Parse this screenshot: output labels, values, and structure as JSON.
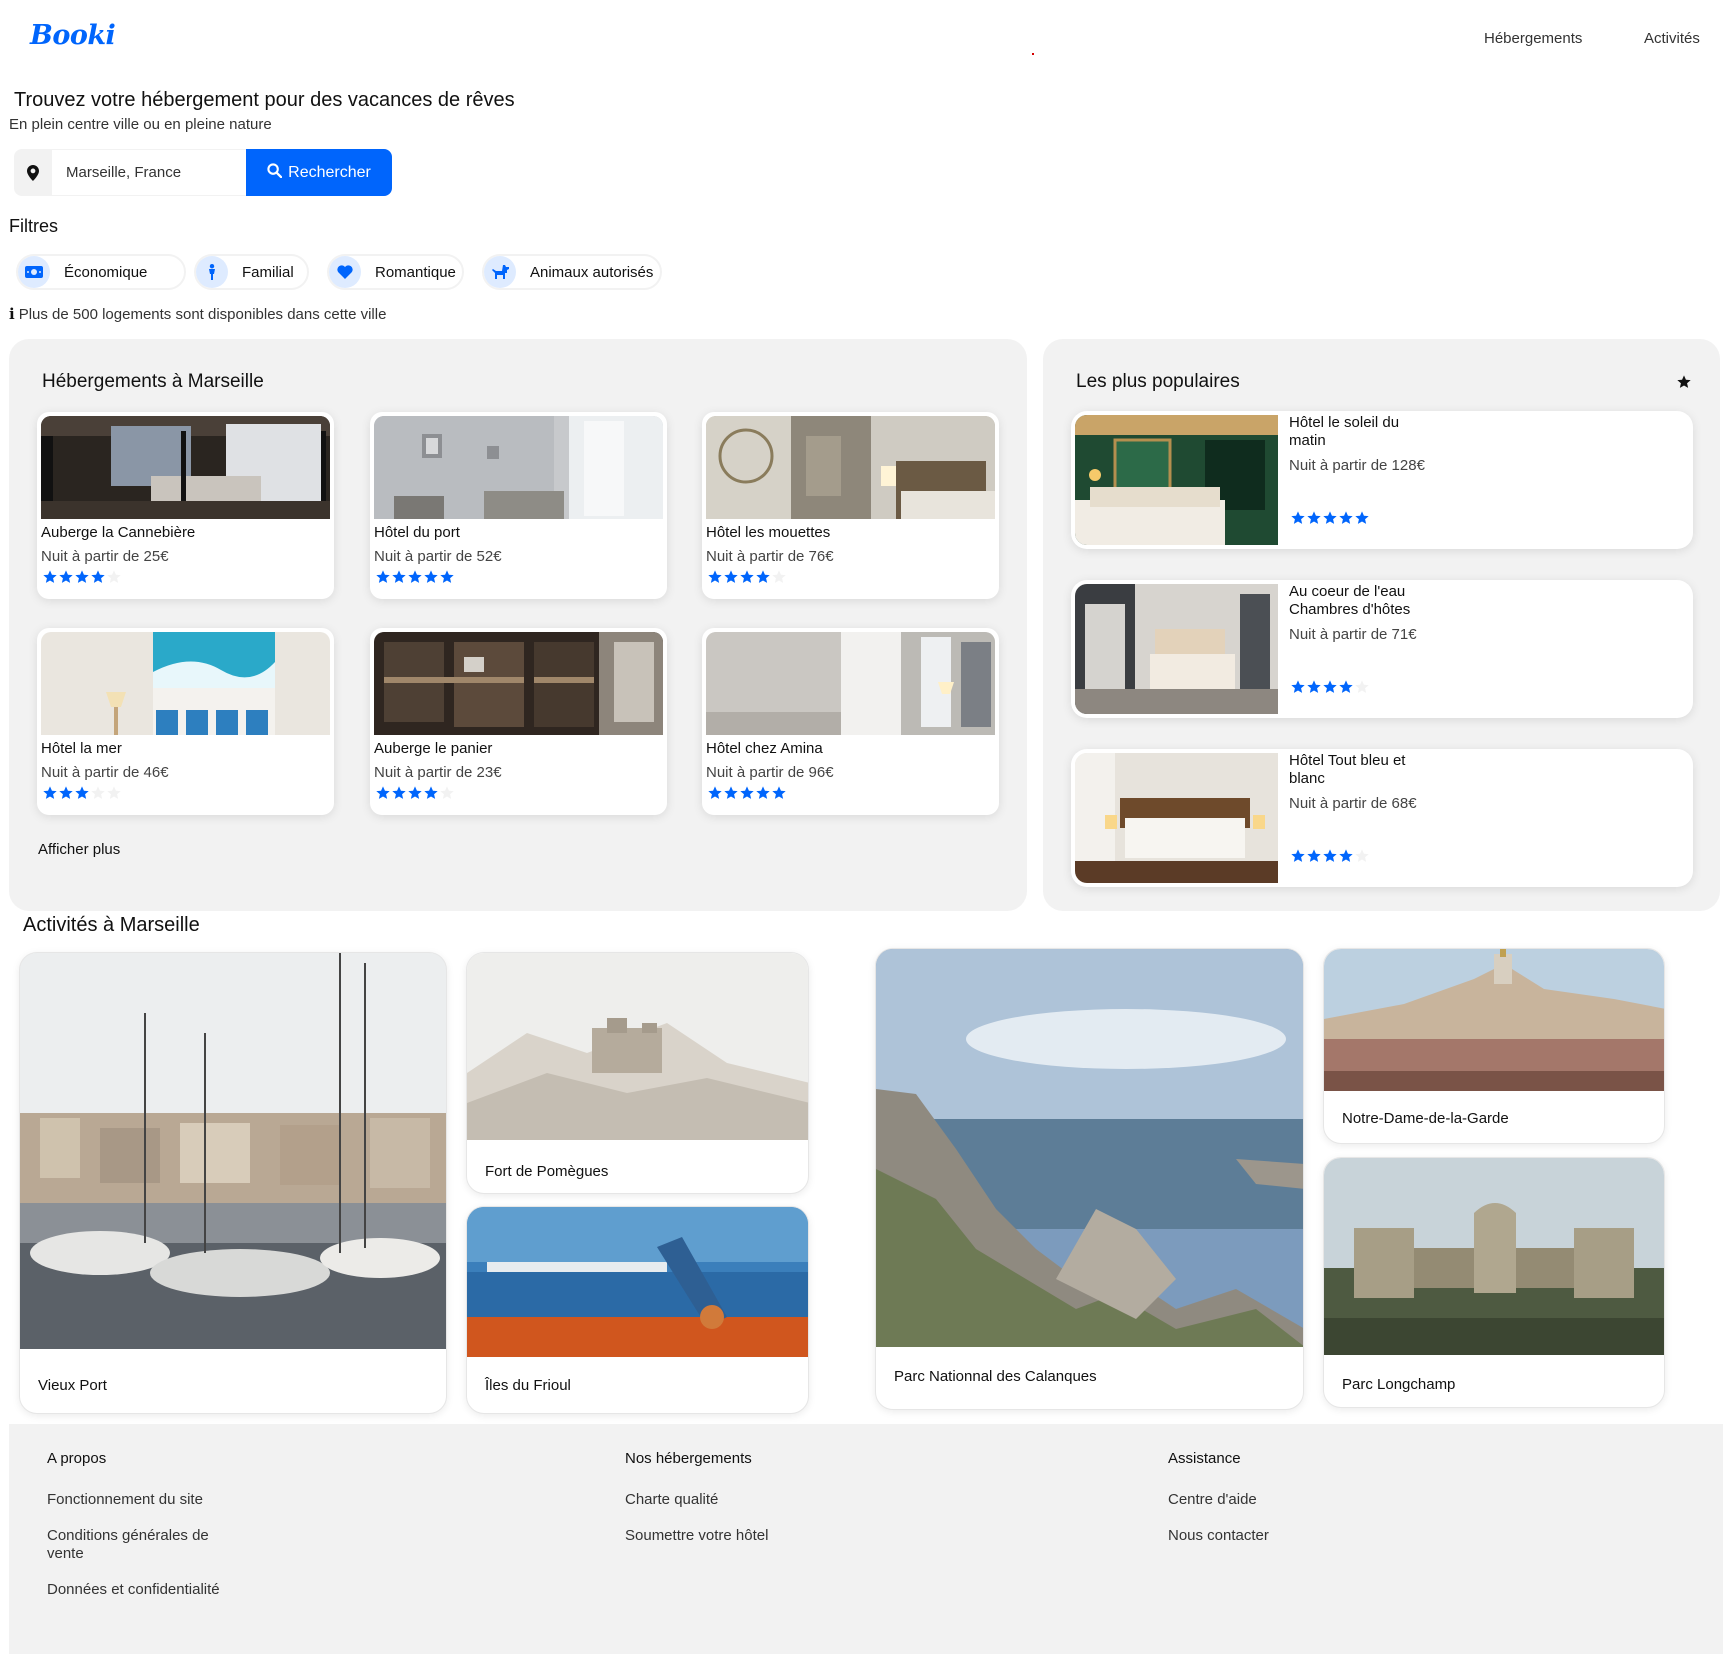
{
  "header": {
    "logo": "Booki",
    "nav": [
      "Hébergements",
      "Activités"
    ]
  },
  "hero": {
    "title": "Trouvez votre hébergement pour des vacances de rêves",
    "subtitle": "En plein centre ville ou en pleine nature"
  },
  "search": {
    "value": "Marseille, France",
    "button_label": "Rechercher"
  },
  "filters": {
    "label": "Filtres",
    "items": [
      {
        "label": "Économique",
        "icon": "money-icon"
      },
      {
        "label": "Familial",
        "icon": "child-icon"
      },
      {
        "label": "Romantique",
        "icon": "heart-icon"
      },
      {
        "label": "Animaux autorisés",
        "icon": "dog-icon"
      }
    ]
  },
  "info": {
    "icon": "i",
    "text": "Plus de 500 logements sont disponibles dans cette ville"
  },
  "hebergements": {
    "title": "Hébergements à Marseille",
    "items": [
      {
        "name": "Auberge la Cannebière",
        "price": "Nuit à partir de 25€",
        "rating": 4
      },
      {
        "name": "Hôtel du port",
        "price": "Nuit à partir de 52€",
        "rating": 5
      },
      {
        "name": "Hôtel les mouettes",
        "price": "Nuit à partir de 76€",
        "rating": 4
      },
      {
        "name": "Hôtel la mer",
        "price": "Nuit à partir de 46€",
        "rating": 3
      },
      {
        "name": "Auberge le panier",
        "price": "Nuit à partir de 23€",
        "rating": 4
      },
      {
        "name": "Hôtel chez Amina",
        "price": "Nuit à partir de 96€",
        "rating": 5
      }
    ],
    "show_more": "Afficher plus"
  },
  "populaires": {
    "title": "Les plus populaires",
    "items": [
      {
        "name": "Hôtel le soleil du matin",
        "price": "Nuit à partir de 128€",
        "rating": 5
      },
      {
        "name": "Au coeur de l'eau Chambres d'hôtes",
        "price": "Nuit à partir de 71€",
        "rating": 4
      },
      {
        "name": "Hôtel Tout bleu et blanc",
        "price": "Nuit à partir de 68€",
        "rating": 4
      }
    ]
  },
  "activites": {
    "title": "Activités à Marseille",
    "items": [
      {
        "label": "Vieux Port"
      },
      {
        "label": "Fort de Pomègues"
      },
      {
        "label": "Îles du Frioul"
      },
      {
        "label": "Parc Nationnal des Calanques"
      },
      {
        "label": "Notre-Dame-de-la-Garde"
      },
      {
        "label": "Parc Longchamp"
      }
    ]
  },
  "footer": {
    "columns": [
      {
        "title": "A propos",
        "links": [
          "Fonctionnement du site",
          "Conditions générales de vente",
          "Données et confidentialité"
        ]
      },
      {
        "title": "Nos hébergements",
        "links": [
          "Charte qualité",
          "Soumettre votre hôtel"
        ]
      },
      {
        "title": "Assistance",
        "links": [
          "Centre d'aide",
          "Nous contacter"
        ]
      }
    ]
  },
  "colors": {
    "accent": "#0065fc",
    "accent_light": "#deebff",
    "panel_bg": "#f2f2f2",
    "star_off": "#f2f2f2"
  }
}
